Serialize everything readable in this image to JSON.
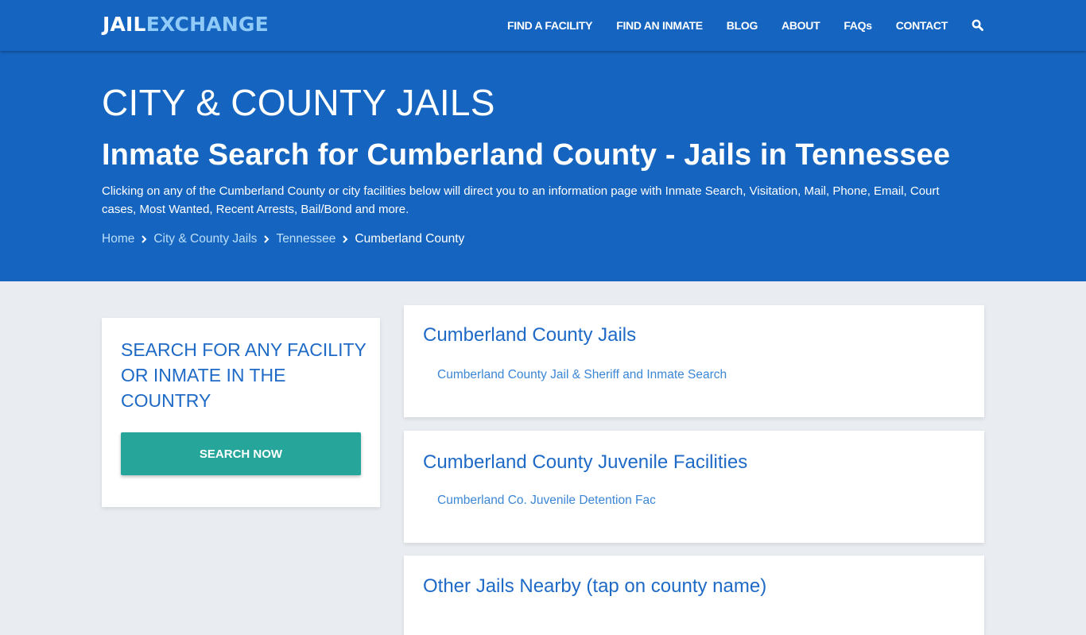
{
  "header": {
    "logo_part1": "JAIL",
    "logo_part2": "EXCHANGE",
    "nav": [
      "FIND A FACILITY",
      "FIND AN INMATE",
      "BLOG",
      "ABOUT",
      "FAQs",
      "CONTACT"
    ],
    "search_icon": "search-icon"
  },
  "hero": {
    "category": "CITY & COUNTY JAILS",
    "title": "Inmate Search for Cumberland County - Jails in Tennessee",
    "description": "Clicking on any of the Cumberland County or city facilities below will direct you to an information page with Inmate Search, Visitation, Mail, Phone, Email, Court cases, Most Wanted, Recent Arrests, Bail/Bond and more.",
    "breadcrumb": [
      "Home",
      "City & County Jails",
      "Tennessee",
      "Cumberland County"
    ]
  },
  "sidebar": {
    "title": "SEARCH FOR ANY FACILITY OR INMATE IN THE COUNTRY",
    "button": "SEARCH NOW"
  },
  "sections": [
    {
      "title": "Cumberland County Jails",
      "links": [
        "Cumberland County Jail & Sheriff and Inmate Search"
      ]
    },
    {
      "title": "Cumberland County Juvenile Facilities",
      "links": [
        "Cumberland Co. Juvenile Detention Fac"
      ]
    },
    {
      "title": "Other Jails Nearby (tap on county name)",
      "links": []
    }
  ],
  "colors": {
    "primary": "#1565c0",
    "accent_light": "#90caf9",
    "button": "#26a69a",
    "link": "#3b87d6",
    "heading": "#1e6ac6"
  }
}
